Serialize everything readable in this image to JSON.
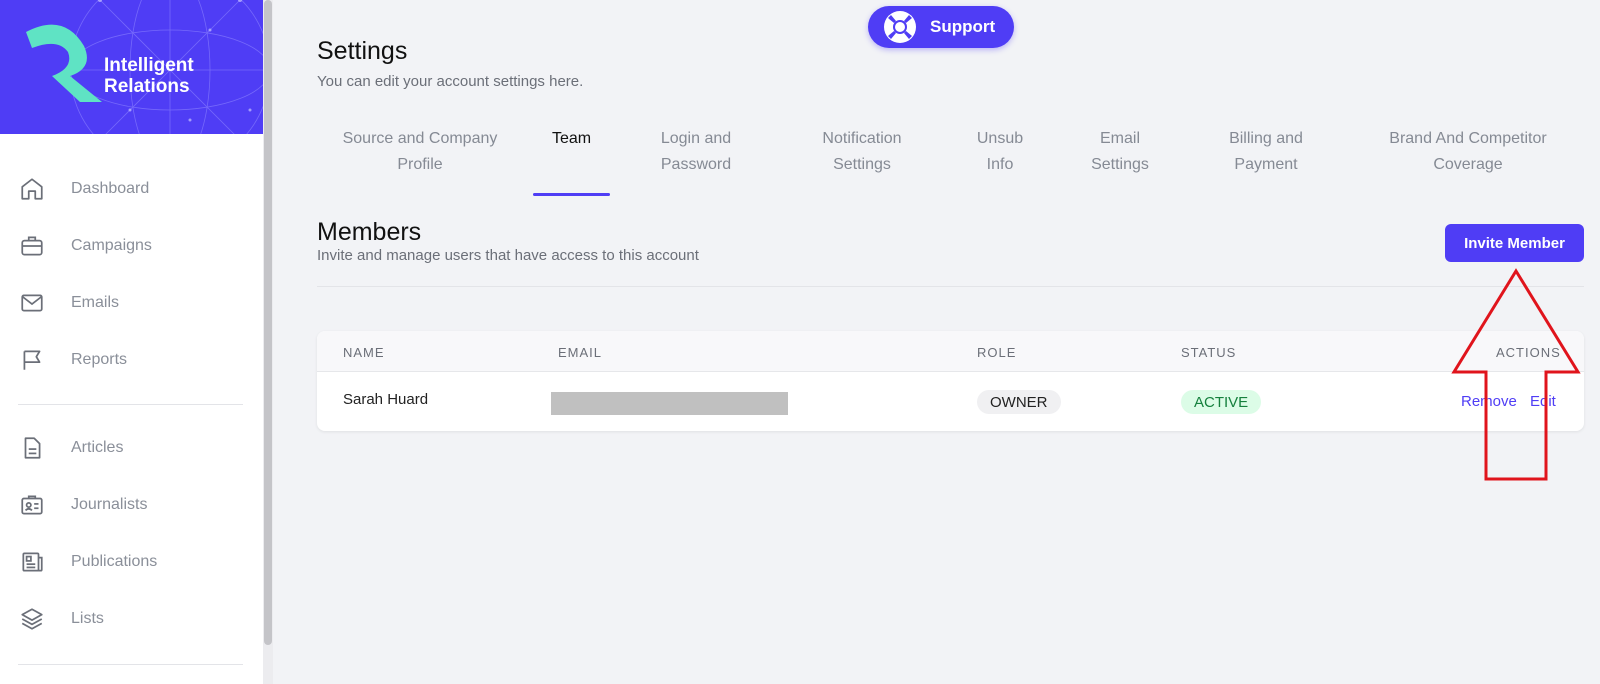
{
  "brand": {
    "name_line1": "Intelligent",
    "name_line2": "Relations",
    "accent": "#4f3df5"
  },
  "support": {
    "label": "Support"
  },
  "header": {
    "title": "Settings",
    "subtitle": "You can edit your account settings here."
  },
  "tabs": [
    {
      "line1": "Source and Company",
      "line2": "Profile"
    },
    {
      "line1": "Team",
      "line2": ""
    },
    {
      "line1": "Login and",
      "line2": "Password"
    },
    {
      "line1": "Notification",
      "line2": "Settings"
    },
    {
      "line1": "Unsub",
      "line2": "Info"
    },
    {
      "line1": "Email",
      "line2": "Settings"
    },
    {
      "line1": "Billing and",
      "line2": "Payment"
    },
    {
      "line1": "Brand And Competitor",
      "line2": "Coverage"
    }
  ],
  "active_tab": "Team",
  "sidebar": {
    "items": [
      {
        "label": "Dashboard",
        "icon": "home-icon"
      },
      {
        "label": "Campaigns",
        "icon": "briefcase-icon"
      },
      {
        "label": "Emails",
        "icon": "mail-icon"
      },
      {
        "label": "Reports",
        "icon": "flag-icon"
      },
      {
        "label": "Articles",
        "icon": "document-icon"
      },
      {
        "label": "Journalists",
        "icon": "id-card-icon"
      },
      {
        "label": "Publications",
        "icon": "newspaper-icon"
      },
      {
        "label": "Lists",
        "icon": "layers-icon"
      }
    ]
  },
  "members": {
    "title": "Members",
    "subtitle": "Invite and manage users that have access to this account",
    "invite_label": "Invite Member",
    "columns": {
      "name": "NAME",
      "email": "EMAIL",
      "role": "ROLE",
      "status": "STATUS",
      "actions": "ACTIONS"
    },
    "rows": [
      {
        "name": "Sarah Huard",
        "role": "OWNER",
        "status": "ACTIVE",
        "remove": "Remove",
        "edit": "Edit"
      }
    ]
  }
}
